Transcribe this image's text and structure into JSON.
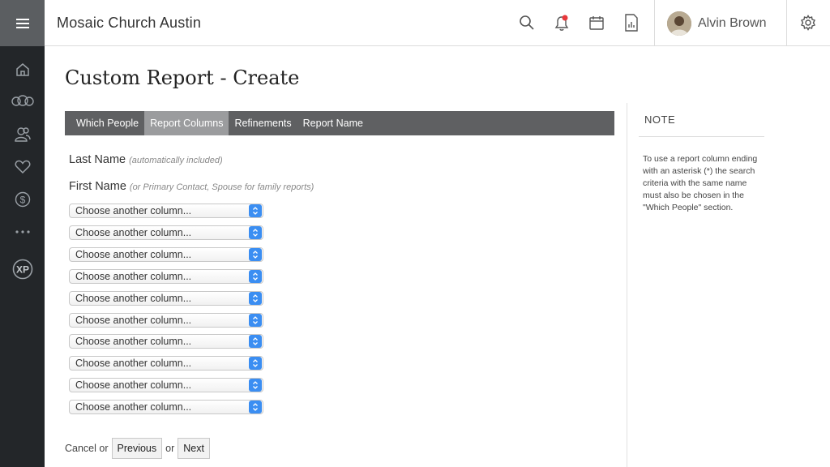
{
  "header": {
    "org_name": "Mosaic Church Austin",
    "user_name": "Alvin Brown",
    "icons": [
      "search-icon",
      "bell-icon",
      "calendar-icon",
      "report-icon",
      "settings-icon"
    ],
    "notification_color": "#e8383b"
  },
  "sidebar": {
    "icons": [
      "menu-icon",
      "home-icon",
      "groups-icon",
      "people-icon",
      "heart-icon",
      "dollar-icon",
      "more-icon",
      "xp-icon"
    ],
    "xp_label": "XP"
  },
  "page": {
    "title": "Custom Report - Create"
  },
  "tabs": [
    {
      "label": "Which People",
      "active": false
    },
    {
      "label": "Report Columns",
      "active": true
    },
    {
      "label": "Refinements",
      "active": false
    },
    {
      "label": "Report Name",
      "active": false
    }
  ],
  "fields": {
    "last_name": {
      "label": "Last Name",
      "note": "(automatically included)"
    },
    "first_name": {
      "label": "First Name",
      "note": "(or Primary Contact, Spouse for family reports)"
    }
  },
  "column_selects": [
    "Choose another column...",
    "Choose another column...",
    "Choose another column...",
    "Choose another column...",
    "Choose another column...",
    "Choose another column...",
    "Choose another column...",
    "Choose another column...",
    "Choose another column...",
    "Choose another column..."
  ],
  "actions": {
    "cancel": "Cancel or",
    "previous": "Previous",
    "or": "or",
    "next": "Next"
  },
  "note_panel": {
    "heading": "NOTE",
    "body": "To use a report column ending with an asterisk (*) the search criteria with the same name must also be chosen in the \"Which People\" section."
  },
  "colors": {
    "sidebar_bg": "#232629",
    "menu_btn_bg": "#5b5e61",
    "tab_bar_bg": "#5f6062",
    "tab_active_bg": "#9b9c9e",
    "select_arrow": "#3b8ef2"
  }
}
